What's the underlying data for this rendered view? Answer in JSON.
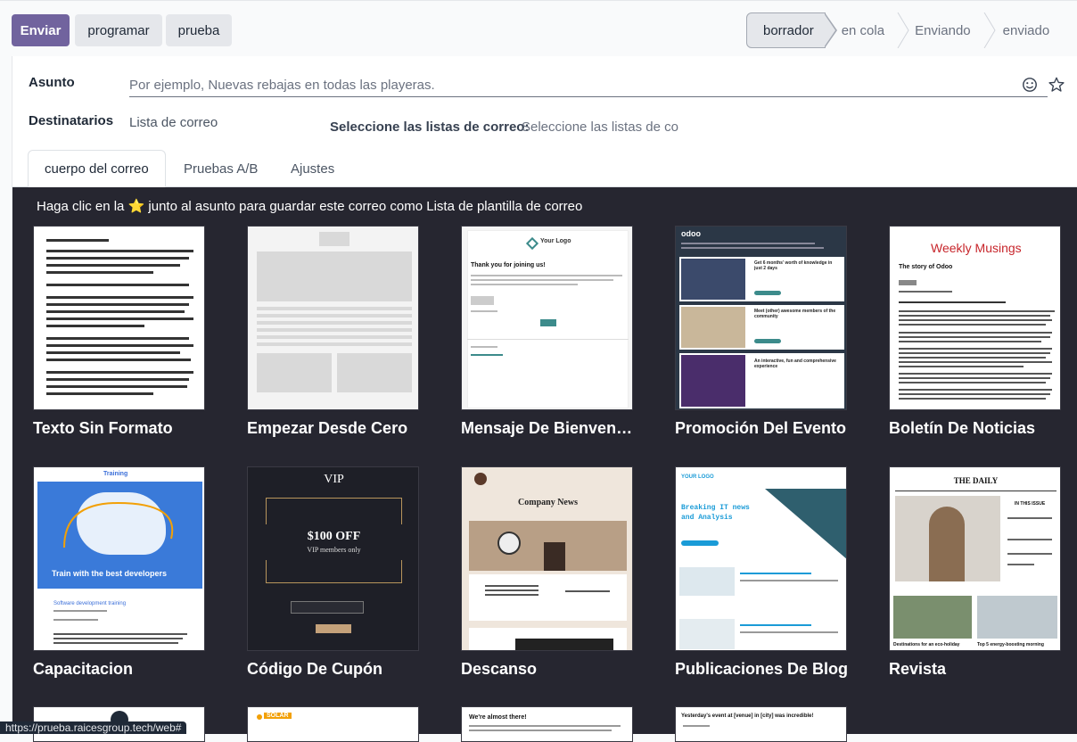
{
  "toolbar": {
    "send_label": "Enviar",
    "schedule_label": "programar",
    "test_label": "prueba"
  },
  "status_bar": {
    "stages": [
      "borrador",
      "en cola",
      "Enviando",
      "enviado"
    ],
    "active": "borrador"
  },
  "form": {
    "subject_label": "Asunto",
    "subject_placeholder": "Por ejemplo, Nuevas rebajas en todas las playeras.",
    "recipients_label": "Destinatarios",
    "recipients_value": "Lista de correo",
    "mailing_lists_label": "Seleccione las listas de correo:",
    "mailing_lists_placeholder": "Seleccione las listas de co"
  },
  "tabs": [
    "cuerpo del correo",
    "Pruebas A/B",
    "Ajustes"
  ],
  "template_area": {
    "hint": "Haga clic en la ⭐ junto al asunto para guardar este correo como Lista de plantilla de correo",
    "templates": [
      {
        "name": "Texto Sin Formato"
      },
      {
        "name": "Empezar Desde Cero"
      },
      {
        "name": "Mensaje De Bienvenida"
      },
      {
        "name": "Promoción Del Evento"
      },
      {
        "name": "Boletín De Noticias"
      },
      {
        "name": "Capacitacion"
      },
      {
        "name": "Código De Cupón"
      },
      {
        "name": "Descanso"
      },
      {
        "name": "Publicaciones De Blog"
      },
      {
        "name": "Revista"
      }
    ],
    "thumb_text": {
      "welcome_logo": "Your Logo",
      "welcome_title": "Thank you for joining us!",
      "newsletter_title": "Weekly Musings",
      "newsletter_sub": "The story of Odoo",
      "event_brand": "odoo",
      "event_item1": "Get 6 months' worth of knowledge in just 2 days",
      "event_item2": "Meet (other) awesome members of the community",
      "event_item3": "An interactive, fun and comprehensive experience",
      "training_brand": "Training",
      "training_title": "Train with the best developers",
      "training_sub": "Software development training",
      "coupon_vip": "VIP",
      "coupon_offer": "$100 OFF",
      "coupon_sub": "VIP members only",
      "break_title": "Company News",
      "blog_logo": "YOUR LOGO",
      "blog_title": "Breaking IT news and Analysis",
      "magazine_title": "THE DAILY",
      "magazine_issue": "IN THIS ISSUE",
      "magazine_cap1": "Destinations for an eco-holiday",
      "magazine_cap2": "Top 5 energy-boosting morning",
      "solar": "SOLAR",
      "almost": "We're almost there!",
      "yesterday": "Yesterday's event at [venue] in [city] was incredible!"
    }
  },
  "status_url": "https://prueba.raicesgroup.tech/web#"
}
